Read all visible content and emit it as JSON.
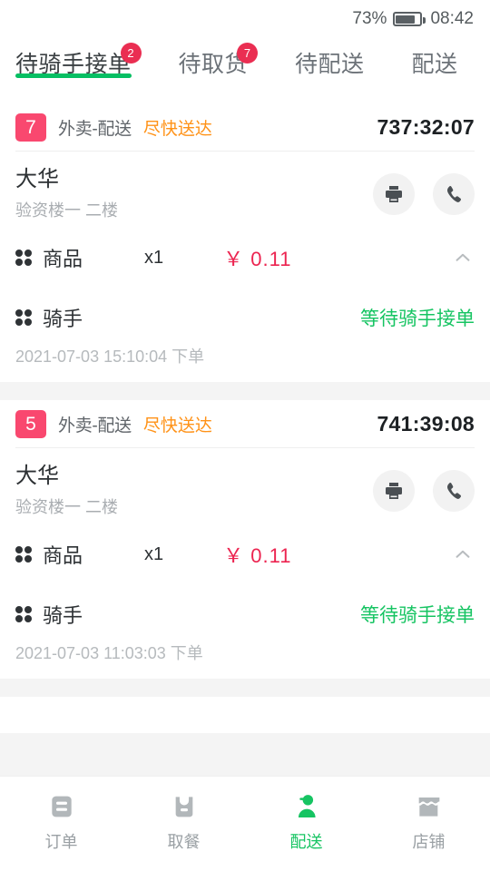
{
  "statusbar": {
    "battery_percent": "73%",
    "battery_level": 73,
    "time": "08:42",
    "battery_icon": "battery-icon"
  },
  "tabs": [
    {
      "label": "待骑手接单",
      "badge": "2",
      "active": true
    },
    {
      "label": "待取货",
      "badge": "7",
      "active": false
    },
    {
      "label": "待配送",
      "badge": "",
      "active": false
    },
    {
      "label": "配送",
      "badge": "",
      "active": false
    }
  ],
  "colors": {
    "accent_green": "#06bf63",
    "status_green": "#16c462",
    "badge_red": "#ea2e52",
    "order_no_pink": "#f9486f",
    "price_red": "#ec2450",
    "urgency_orange": "#ff9217",
    "page_bg": "#f4f4f4"
  },
  "orders": [
    {
      "order_no": "7",
      "order_type": "外卖-配送",
      "urgency": "尽快送达",
      "timer": "737:32:07",
      "customer_name": "大华",
      "customer_address": "验资楼一 二楼",
      "print_icon": "printer-icon",
      "call_icon": "phone-icon",
      "goods_label": "商品",
      "goods_qty": "x1",
      "goods_price": "￥ 0.11",
      "collapse_icon": "chevron-up-icon",
      "rider_label": "骑手",
      "rider_status": "等待骑手接单",
      "order_time": "2021-07-03 15:10:04 下单"
    },
    {
      "order_no": "5",
      "order_type": "外卖-配送",
      "urgency": "尽快送达",
      "timer": "741:39:08",
      "customer_name": "大华",
      "customer_address": "验资楼一 二楼",
      "print_icon": "printer-icon",
      "call_icon": "phone-icon",
      "goods_label": "商品",
      "goods_qty": "x1",
      "goods_price": "￥ 0.11",
      "collapse_icon": "chevron-up-icon",
      "rider_label": "骑手",
      "rider_status": "等待骑手接单",
      "order_time": "2021-07-03 11:03:03 下单"
    }
  ],
  "bottomnav": [
    {
      "label": "订单",
      "icon": "order-list-icon",
      "active": false
    },
    {
      "label": "取餐",
      "icon": "takeout-bag-icon",
      "active": false
    },
    {
      "label": "配送",
      "icon": "delivery-person-icon",
      "active": true
    },
    {
      "label": "店铺",
      "icon": "shop-icon",
      "active": false
    }
  ]
}
